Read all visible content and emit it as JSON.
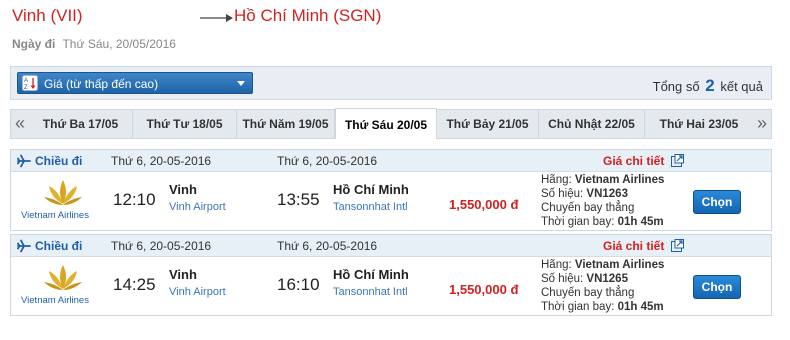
{
  "route": {
    "from": "Vinh (VII)",
    "to": "Hồ Chí Minh (SGN)",
    "date_label": "Ngày đi",
    "date_value": "Thứ Sáu, 20/05/2016"
  },
  "sort": {
    "label": "Giá (từ thấp đến cao)",
    "total_prefix": "Tổng số",
    "total_count": "2",
    "total_suffix": "kết quả"
  },
  "tabs": [
    {
      "label": "Thứ Ba 17/05",
      "active": false
    },
    {
      "label": "Thứ Tư 18/05",
      "active": false
    },
    {
      "label": "Thứ Năm 19/05",
      "active": false
    },
    {
      "label": "Thứ Sáu 20/05",
      "active": true
    },
    {
      "label": "Thứ Bảy 21/05",
      "active": false
    },
    {
      "label": "Chủ Nhật 22/05",
      "active": false
    },
    {
      "label": "Thứ Hai 23/05",
      "active": false
    }
  ],
  "flights": [
    {
      "leg_label": "Chiều đi",
      "depart_date": "Thứ 6, 20-05-2016",
      "arrive_date": "Thứ 6, 20-05-2016",
      "detail_label": "Giá chi tiết",
      "airline_name": "Vietnam Airlines",
      "depart_time": "12:10",
      "depart_city": "Vinh",
      "depart_airport": "Vinh Airport",
      "arrive_time": "13:55",
      "arrive_city": "Hồ Chí Minh",
      "arrive_airport": "Tansonnhat Intl",
      "price": "1,550,000 đ",
      "carrier_label": "Hãng:",
      "carrier": "Vietnam Airlines",
      "flight_no_label": "Số hiệu:",
      "flight_no": "VN1263",
      "route_type": "Chuyến bay thẳng",
      "duration_label": "Thời gian bay:",
      "duration": "01h 45m",
      "select_label": "Chọn"
    },
    {
      "leg_label": "Chiều đi",
      "depart_date": "Thứ 6, 20-05-2016",
      "arrive_date": "Thứ 6, 20-05-2016",
      "detail_label": "Giá chi tiết",
      "airline_name": "Vietnam Airlines",
      "depart_time": "14:25",
      "depart_city": "Vinh",
      "depart_airport": "Vinh Airport",
      "arrive_time": "16:10",
      "arrive_city": "Hồ Chí Minh",
      "arrive_airport": "Tansonnhat Intl",
      "price": "1,550,000 đ",
      "carrier_label": "Hãng:",
      "carrier": "Vietnam Airlines",
      "flight_no_label": "Số hiệu:",
      "flight_no": "VN1265",
      "route_type": "Chuyến bay thẳng",
      "duration_label": "Thời gian bay:",
      "duration": "01h 45m",
      "select_label": "Chọn"
    }
  ],
  "colors": {
    "accent_red": "#d42020",
    "brand_blue": "#1f5fa6",
    "logo_gold": "#d9a520"
  },
  "icons": {
    "arrow": "right-arrow-icon",
    "sort": "sort-az-icon",
    "caret": "chevron-down-icon",
    "plane": "plane-icon",
    "detail": "external-link-icon",
    "logo": "lotus-logo-icon"
  }
}
